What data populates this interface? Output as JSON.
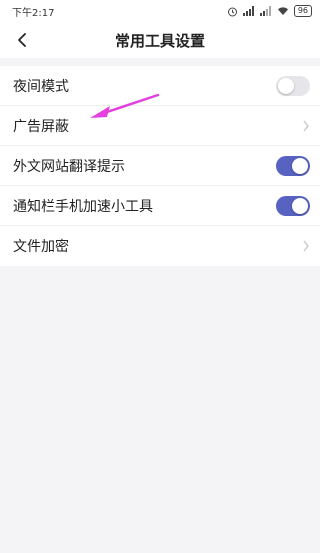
{
  "status_bar": {
    "time": "下午2:17",
    "battery": "96",
    "icons": [
      "alarm-icon",
      "signal-icon",
      "signal-icon",
      "wifi-icon",
      "battery-icon"
    ]
  },
  "header": {
    "title": "常用工具设置",
    "back_icon": "chevron-left-icon"
  },
  "settings": {
    "items": [
      {
        "label": "夜间模式",
        "control": "toggle",
        "enabled": false
      },
      {
        "label": "广告屏蔽",
        "control": "chevron"
      },
      {
        "label": "外文网站翻译提示",
        "control": "toggle",
        "enabled": true
      },
      {
        "label": "通知栏手机加速小工具",
        "control": "toggle",
        "enabled": true
      },
      {
        "label": "文件加密",
        "control": "chevron"
      }
    ]
  },
  "colors": {
    "toggle_on": "#5862c0",
    "toggle_off": "#e6e6ea",
    "annotation_arrow": "#e63fe0",
    "background": "#f4f4f6"
  }
}
